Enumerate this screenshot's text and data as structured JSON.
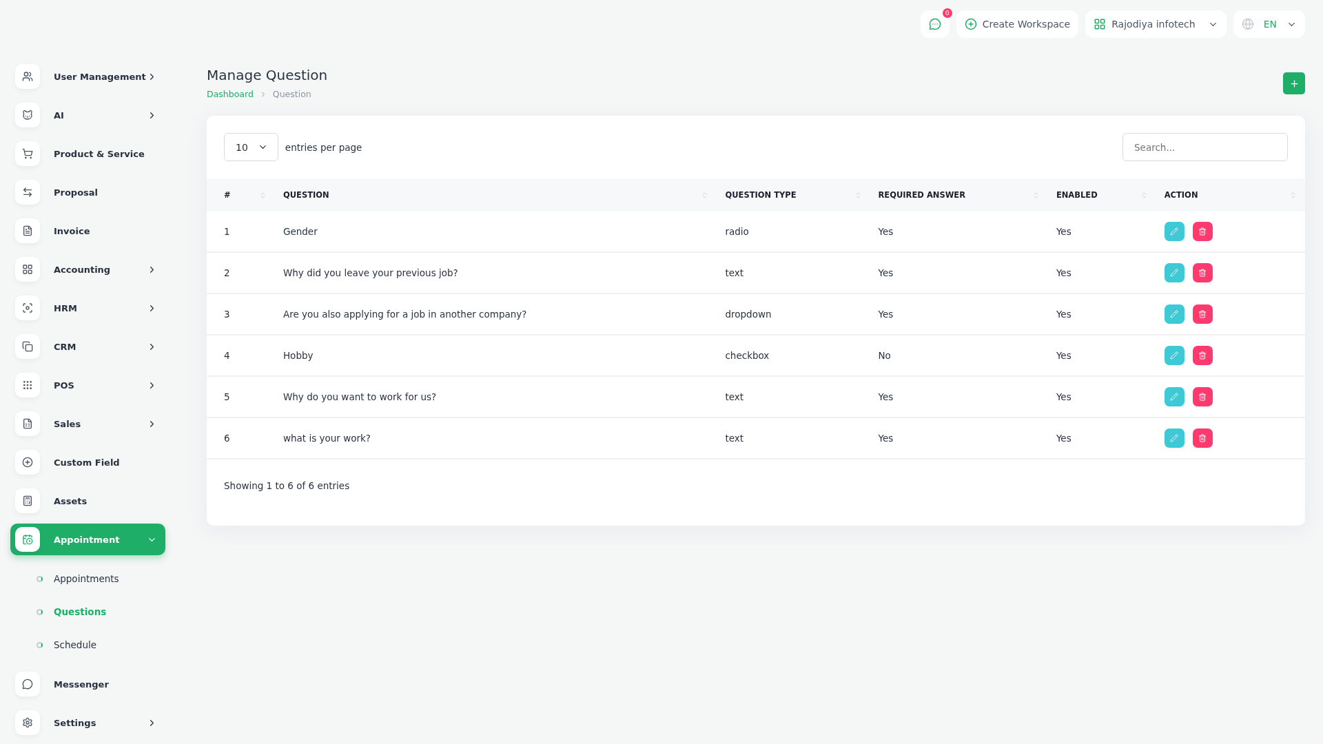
{
  "topbar": {
    "messages_badge": "0",
    "create_workspace": "Create Workspace",
    "workspace": "Rajodiya infotech",
    "language": "EN"
  },
  "sidebar": {
    "items": [
      {
        "label": "User Management",
        "has_submenu": true,
        "selected": false
      },
      {
        "label": "AI",
        "has_submenu": true,
        "selected": false
      },
      {
        "label": "Product & Service",
        "has_submenu": false,
        "selected": false
      },
      {
        "label": "Proposal",
        "has_submenu": false,
        "selected": false
      },
      {
        "label": "Invoice",
        "has_submenu": false,
        "selected": false
      },
      {
        "label": "Accounting",
        "has_submenu": true,
        "selected": false
      },
      {
        "label": "HRM",
        "has_submenu": true,
        "selected": false
      },
      {
        "label": "CRM",
        "has_submenu": true,
        "selected": false
      },
      {
        "label": "POS",
        "has_submenu": true,
        "selected": false
      },
      {
        "label": "Sales",
        "has_submenu": true,
        "selected": false
      },
      {
        "label": "Custom Field",
        "has_submenu": false,
        "selected": false
      },
      {
        "label": "Assets",
        "has_submenu": false,
        "selected": false
      },
      {
        "label": "Appointment",
        "has_submenu": true,
        "selected": true,
        "expanded": true,
        "children": [
          {
            "label": "Appointments",
            "selected": false
          },
          {
            "label": "Questions",
            "selected": true
          },
          {
            "label": "Schedule",
            "selected": false
          }
        ]
      },
      {
        "label": "Messenger",
        "has_submenu": false,
        "selected": false
      },
      {
        "label": "Settings",
        "has_submenu": true,
        "selected": false
      }
    ]
  },
  "page": {
    "title": "Manage Question",
    "breadcrumb": [
      "Dashboard",
      "Question"
    ]
  },
  "table": {
    "page_size": "10",
    "page_size_label": "entries per page",
    "search_placeholder": "Search...",
    "columns": [
      "#",
      "QUESTION",
      "QUESTION TYPE",
      "REQUIRED ANSWER",
      "ENABLED",
      "ACTION"
    ],
    "rows": [
      {
        "number": "1",
        "question": "Gender",
        "type": "radio",
        "required": "Yes",
        "enabled": "Yes"
      },
      {
        "number": "2",
        "question": "Why did you leave your previous job?",
        "type": "text",
        "required": "Yes",
        "enabled": "Yes"
      },
      {
        "number": "3",
        "question": "Are you also applying for a job in another company?",
        "type": "dropdown",
        "required": "Yes",
        "enabled": "Yes"
      },
      {
        "number": "4",
        "question": "Hobby",
        "type": "checkbox",
        "required": "No",
        "enabled": "Yes"
      },
      {
        "number": "5",
        "question": "Why do you want to work for us?",
        "type": "text",
        "required": "Yes",
        "enabled": "Yes"
      },
      {
        "number": "6",
        "question": "what is your work?",
        "type": "text",
        "required": "Yes",
        "enabled": "Yes"
      }
    ],
    "footer": "Showing 1 to 6 of 6 entries"
  }
}
